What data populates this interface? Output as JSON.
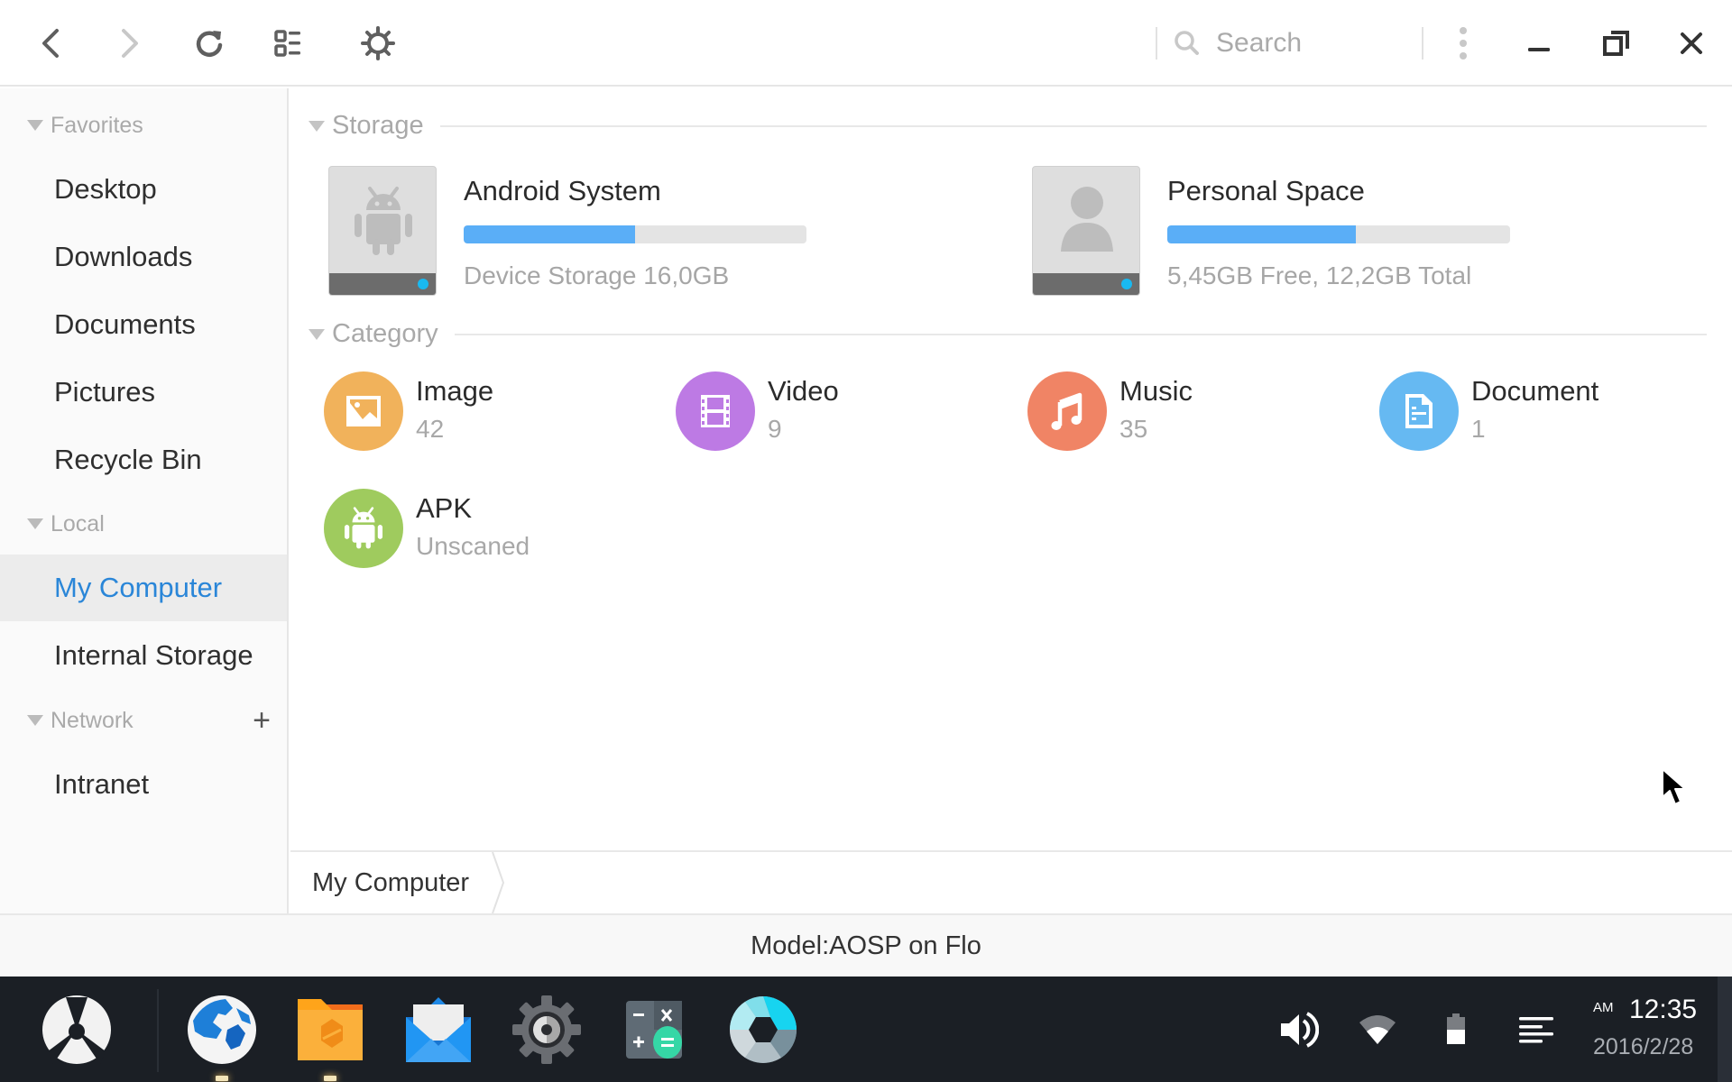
{
  "toolbar": {
    "back_icon": "chevron-left-icon",
    "forward_icon": "chevron-right-icon",
    "refresh_icon": "refresh-icon",
    "view_icon": "list-view-icon",
    "settings_icon": "gear-icon",
    "search_placeholder": "Search",
    "search_value": "",
    "menu_icon": "more-vertical-icon",
    "minimize_icon": "minimize-icon",
    "restore_icon": "restore-icon",
    "close_icon": "close-icon"
  },
  "sidebar": {
    "sections": [
      {
        "title": "Favorites",
        "items": [
          "Desktop",
          "Downloads",
          "Documents",
          "Pictures",
          "Recycle Bin"
        ]
      },
      {
        "title": "Local",
        "items": [
          "My Computer",
          "Internal Storage"
        ]
      },
      {
        "title": "Network",
        "add_label": "+",
        "items": [
          "Intranet"
        ]
      }
    ],
    "active_item": "My Computer"
  },
  "storage": {
    "title": "Storage",
    "drives": [
      {
        "name": "Android System",
        "subtitle": "Device Storage 16,0GB",
        "used_fraction": 0.5,
        "icon": "android-icon"
      },
      {
        "name": "Personal Space",
        "subtitle": "5,45GB Free, 12,2GB Total",
        "used_fraction": 0.55,
        "icon": "person-icon"
      }
    ]
  },
  "category": {
    "title": "Category",
    "items": [
      {
        "label": "Image",
        "count": "42",
        "color": "#f1b25b",
        "icon": "image-icon"
      },
      {
        "label": "Video",
        "count": "9",
        "color": "#bd7ae4",
        "icon": "film-icon"
      },
      {
        "label": "Music",
        "count": "35",
        "color": "#f08465",
        "icon": "music-note-icon"
      },
      {
        "label": "Document",
        "count": "1",
        "color": "#66b9f2",
        "icon": "document-icon"
      },
      {
        "label": "APK",
        "count": "Unscaned",
        "color": "#9fcb5e",
        "icon": "android-icon"
      }
    ]
  },
  "breadcrumb": {
    "items": [
      "My Computer"
    ]
  },
  "status": {
    "text": "Model:AOSP on Flo"
  },
  "taskbar": {
    "apps": [
      "start-menu",
      "browser",
      "file-manager",
      "email",
      "settings",
      "calculator",
      "camera"
    ],
    "running": [
      "browser",
      "file-manager"
    ],
    "tray": [
      "volume-icon",
      "wifi-icon",
      "battery-icon",
      "notifications-icon"
    ],
    "clock": {
      "ampm": "AM",
      "time": "12:35",
      "date": "2016/2/28"
    }
  },
  "colors": {
    "accent": "#2a86d8",
    "progress": "#5aaef7",
    "taskbar": "#1b1f25"
  }
}
